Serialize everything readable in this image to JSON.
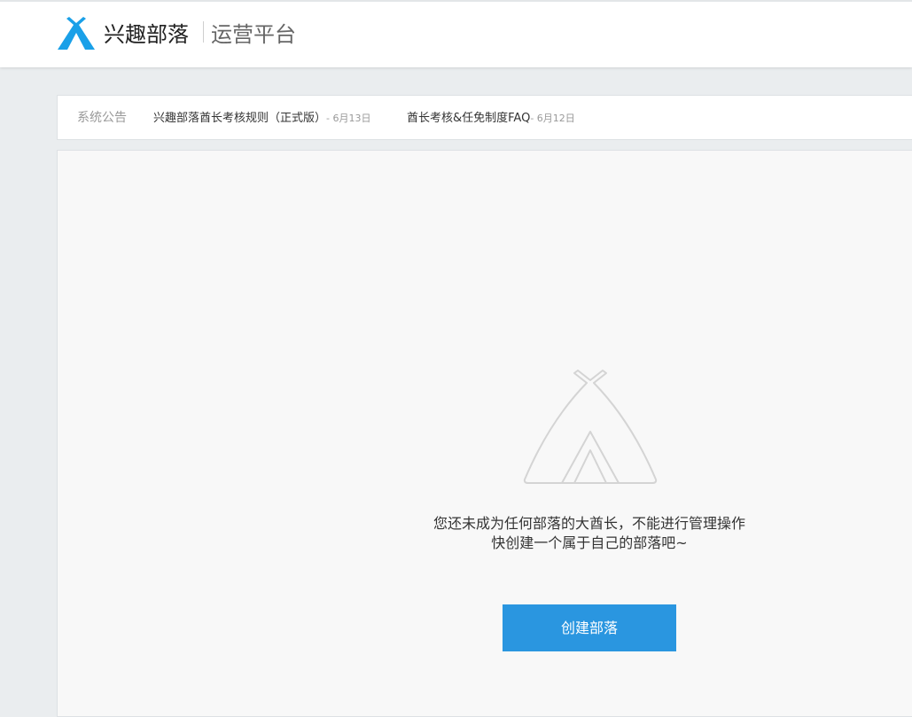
{
  "header": {
    "brand_name": "兴趣部落",
    "platform_name": "运营平台",
    "logo_icon": "tent-logo-icon",
    "brand_color": "#1aa0e8"
  },
  "notice_bar": {
    "label": "系统公告",
    "items": [
      {
        "title": "兴趣部落酋长考核规则（正式版）",
        "date": "- 6月13日"
      },
      {
        "title": "酋长考核&任免制度FAQ",
        "date": "- 6月12日"
      }
    ]
  },
  "main": {
    "empty_icon": "tent-outline-icon",
    "message_line1": "您还未成为任何部落的大酋长，不能进行管理操作",
    "message_line2": "快创建一个属于自己的部落吧~",
    "create_button_label": "创建部落",
    "button_color": "#2a96e0"
  }
}
